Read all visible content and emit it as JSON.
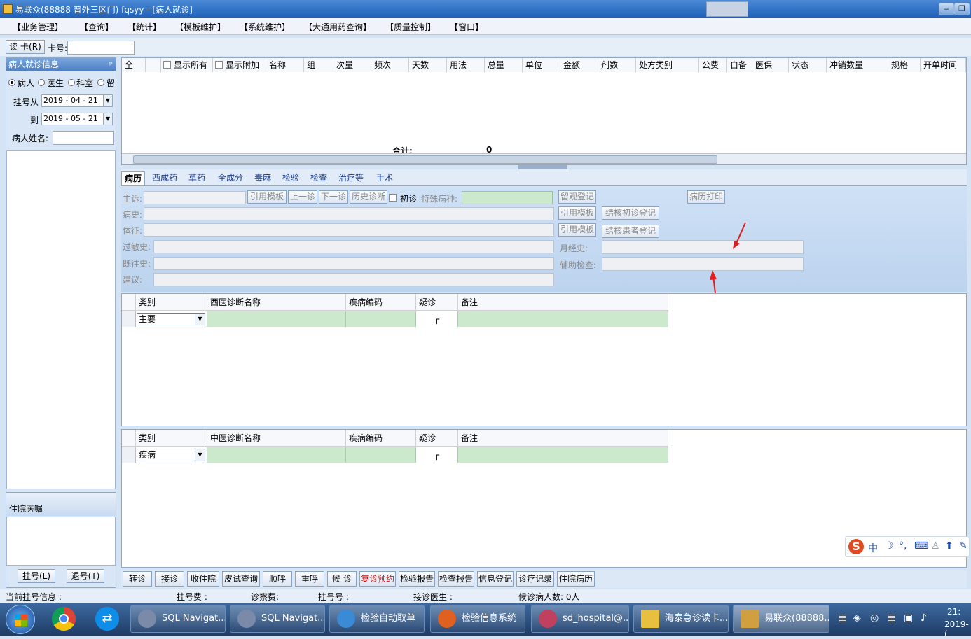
{
  "window": {
    "title": "易联众(88888 普外三区门) fqsyy - [病人就诊]"
  },
  "menu": [
    "【业务管理】",
    "【查询】",
    "【统计】",
    "【模板维护】",
    "【系统维护】",
    "【大通用药查询】",
    "【质量控制】",
    "【窗口】"
  ],
  "cardbar": {
    "read_card": "读 卡(R)",
    "card_no_label": "卡号:",
    "card_no_value": ""
  },
  "leftpanel": {
    "header": "病人就诊信息",
    "pin": "ᵖ",
    "radios": [
      "病人",
      "医生",
      "科室",
      "留"
    ],
    "reg_from_label": "挂号从",
    "reg_from": "2019 - 04 - 21",
    "reg_to_label": "到",
    "reg_to": "2019 - 05 - 21",
    "name_label": "病人姓名:",
    "name_value": "",
    "inpatient_header": "住院医嘱",
    "register_button": "挂号(L)",
    "unregister_button": "退号(T)"
  },
  "rxgrid": {
    "columns": [
      "全",
      "显示所有",
      "显示附加",
      "名称",
      "组",
      "次量",
      "频次",
      "天数",
      "用法",
      "总量",
      "单位",
      "金额",
      "剂数",
      "处方类别",
      "公费",
      "自备",
      "医保",
      "状态",
      "冲销数量",
      "规格",
      "开单时间"
    ],
    "total_label": "合计:",
    "total_value": "0"
  },
  "tabs": [
    "病历",
    "西成药",
    "草药",
    "全成分",
    "毒麻",
    "检验",
    "检查",
    "治疗等",
    "手术"
  ],
  "form": {
    "complaint": "主诉:",
    "history": "病史:",
    "signs": "体征:",
    "allergy": "过敏史:",
    "past": "既往史:",
    "advice": "建议:",
    "cite_template": "引用模板",
    "prev_visit": "上一诊",
    "next_visit": "下一诊",
    "history_diag": "历史诊断",
    "first_visit": "初诊",
    "special_disease": "特殊病种:",
    "observe_register": "留观登记",
    "print_record": "病历打印",
    "cite_template2": "引用模板",
    "cite_template3": "引用模板",
    "tb_first_register": "结核初诊登记",
    "tb_patient_register": "结核患者登记",
    "menstrual": "月经史:",
    "aux_exam": "辅助检查:"
  },
  "western_dx": {
    "headers": [
      "类别",
      "西医诊断名称",
      "疾病编码",
      "疑诊",
      "备注"
    ],
    "row_type": "主要",
    "suspect": "┌"
  },
  "chinese_dx": {
    "headers": [
      "类别",
      "中医诊断名称",
      "疾病编码",
      "疑诊",
      "备注"
    ],
    "row_type": "疾病",
    "suspect": "┌"
  },
  "actions": [
    "转诊",
    "接诊",
    "收住院",
    "皮试查询",
    "顺呼",
    "重呼",
    "候 诊",
    "复诊预约",
    "检验报告",
    "检查报告",
    "信息登记",
    "诊疗记录",
    "住院病历"
  ],
  "status": {
    "current_reg": "当前挂号信息 :",
    "reg_fee": "挂号费 :",
    "exam_fee": "诊察费:",
    "reg_no": "挂号号 :",
    "doctor": "接诊医生 :",
    "waiting": "候诊病人数: 0人"
  },
  "ime": {
    "label": "中"
  },
  "taskbar": {
    "items": [
      {
        "label": "SQL Navigat...",
        "color": "#7a8aa8"
      },
      {
        "label": "SQL Navigat...",
        "color": "#7a8aa8"
      },
      {
        "label": "检验自动取单",
        "color": "#3a8ad6"
      },
      {
        "label": "检验信息系统",
        "color": "#e06020"
      },
      {
        "label": "sd_hospital@...",
        "color": "#c04060"
      },
      {
        "label": "海泰急诊读卡...",
        "color": "#e8c040"
      },
      {
        "label": "易联众(88888...",
        "color": "#d0a040"
      }
    ],
    "clock_time": "21:",
    "clock_date": "2019-("
  },
  "colors": {
    "accent": "#4d80c4",
    "grid_green": "#cde9cd",
    "annotation_red": "#e02020"
  }
}
